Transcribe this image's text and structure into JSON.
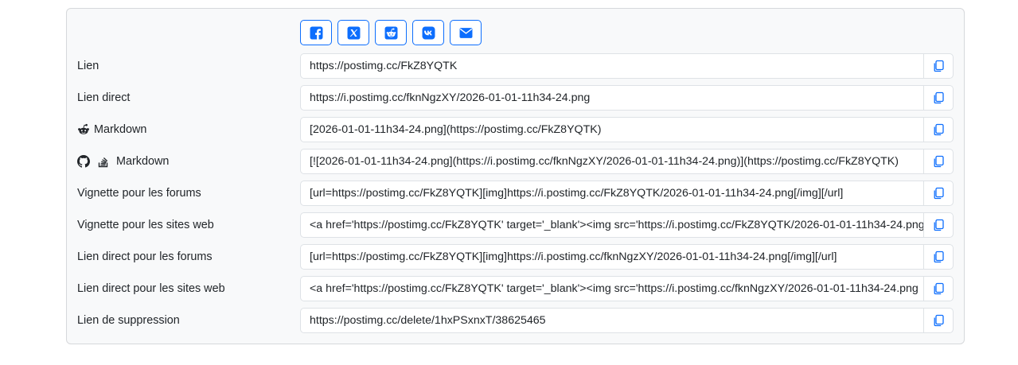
{
  "colors": {
    "accent": "#0d6efd",
    "card_background": "#f8f9fa",
    "border": "#dee2e6",
    "text": "#212529"
  },
  "share_buttons": [
    {
      "icon": "facebook-icon"
    },
    {
      "icon": "x-icon"
    },
    {
      "icon": "reddit-icon"
    },
    {
      "icon": "vk-icon"
    },
    {
      "icon": "email-icon"
    }
  ],
  "rows": [
    {
      "label": "Lien",
      "value": "https://postimg.cc/FkZ8YQTK"
    },
    {
      "label": "Lien direct",
      "value": "https://i.postimg.cc/fknNgzXY/2026-01-01-11h34-24.png"
    },
    {
      "label": "Markdown",
      "icons": [
        "reddit-icon"
      ],
      "value": "[2026-01-01-11h34-24.png](https://postimg.cc/FkZ8YQTK)"
    },
    {
      "label": "Markdown",
      "icons": [
        "github-icon",
        "stackoverflow-icon"
      ],
      "value": "[![2026-01-01-11h34-24.png](https://i.postimg.cc/fknNgzXY/2026-01-01-11h34-24.png)](https://postimg.cc/FkZ8YQTK)"
    },
    {
      "label": "Vignette pour les forums",
      "value": "[url=https://postimg.cc/FkZ8YQTK][img]https://i.postimg.cc/FkZ8YQTK/2026-01-01-11h34-24.png[/img][/url]"
    },
    {
      "label": "Vignette pour les sites web",
      "value": "<a href='https://postimg.cc/FkZ8YQTK' target='_blank'><img src='https://i.postimg.cc/FkZ8YQTK/2026-01-01-11h34-24.png"
    },
    {
      "label": "Lien direct pour les forums",
      "value": "[url=https://postimg.cc/FkZ8YQTK][img]https://i.postimg.cc/fknNgzXY/2026-01-01-11h34-24.png[/img][/url]"
    },
    {
      "label": "Lien direct pour les sites web",
      "value": "<a href='https://postimg.cc/FkZ8YQTK' target='_blank'><img src='https://i.postimg.cc/fknNgzXY/2026-01-01-11h34-24.png"
    },
    {
      "label": "Lien de suppression",
      "value": "https://postimg.cc/delete/1hxPSxnxT/38625465"
    }
  ]
}
